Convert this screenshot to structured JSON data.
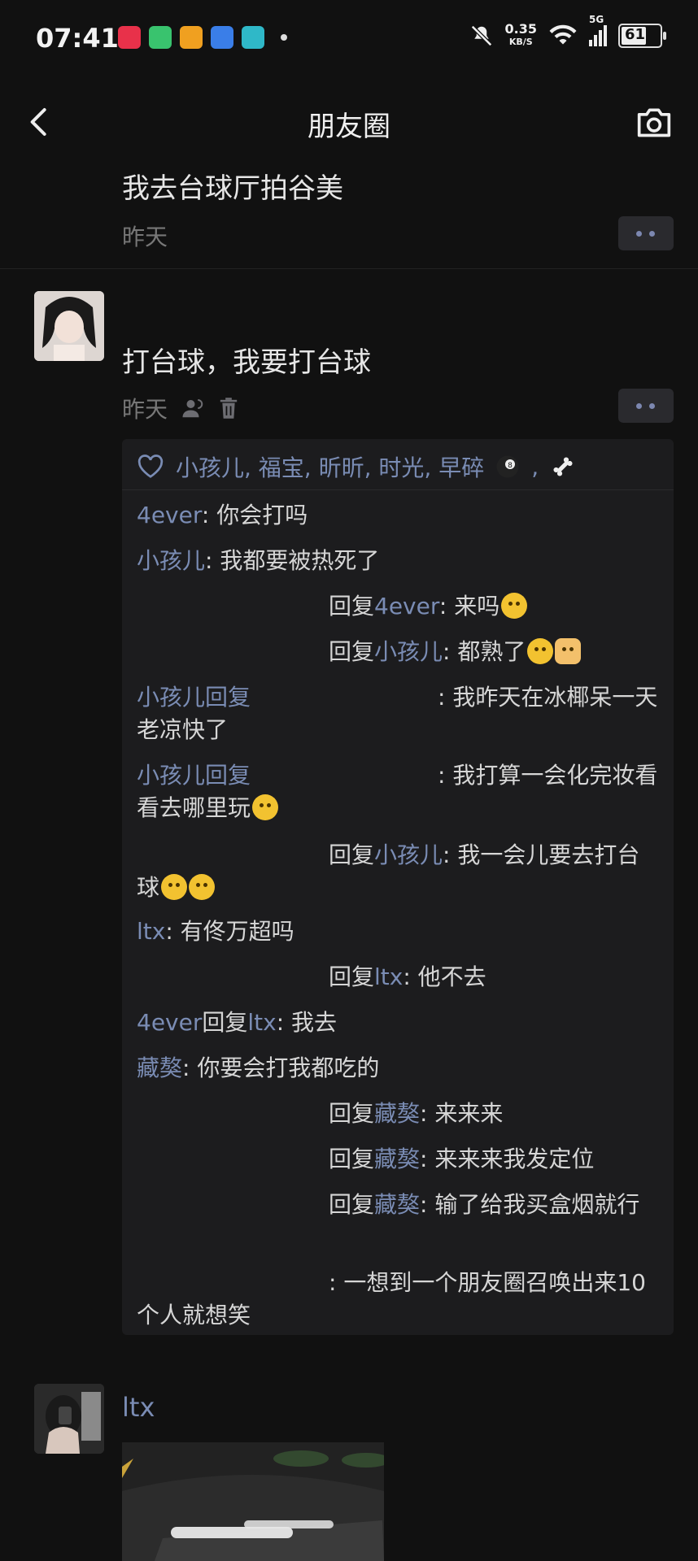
{
  "status_bar": {
    "time": "07:41",
    "speed_value": "0.35",
    "speed_unit": "KB/S",
    "network": "5G",
    "battery": "61"
  },
  "header": {
    "title": "朋友圈"
  },
  "posts": [
    {
      "text": "我去台球厅拍谷美",
      "time": "昨天"
    },
    {
      "text": "打台球，我要打台球",
      "time": "昨天"
    }
  ],
  "likes": "小孩儿, 福宝, 昕昕, 时光, 早碎",
  "comments": [
    {
      "name": "4ever",
      "reply_to": "",
      "text": ": 你会打吗"
    },
    {
      "name": "小孩儿",
      "reply_to": "",
      "text": ": 我都要被热死了"
    },
    {
      "name": "",
      "reply_prefix": "回复",
      "reply_to": "4ever",
      "text": ": 来吗"
    },
    {
      "name": "",
      "reply_prefix": "回复",
      "reply_to": "小孩儿",
      "text": ": 都熟了"
    },
    {
      "name": "小孩儿",
      "reply_prefix": "回复",
      "reply_to": "",
      "text": ": 我昨天在冰椰呆一天老凉快了"
    },
    {
      "name": "小孩儿",
      "reply_prefix": "回复",
      "reply_to": "",
      "text": ": 我打算一会化完妆看看去哪里玩"
    },
    {
      "name": "",
      "reply_prefix": "回复",
      "reply_to": "小孩儿",
      "text": ": 我一会儿要去打台球"
    },
    {
      "name": "ltx",
      "reply_to": "",
      "text": ": 有佟万超吗"
    },
    {
      "name": "",
      "reply_prefix": "回复",
      "reply_to": "ltx",
      "text": ": 他不去"
    },
    {
      "name": "4ever",
      "reply_prefix": "回复",
      "reply_to": "ltx",
      "text": ": 我去"
    },
    {
      "name": "藏獒",
      "reply_to": "",
      "text": ": 你要会打我都吃的"
    },
    {
      "name": "",
      "reply_prefix": "回复",
      "reply_to": "藏獒",
      "text": ": 来来来"
    },
    {
      "name": "",
      "reply_prefix": "回复",
      "reply_to": "藏獒",
      "text": ": 来来来我发定位"
    },
    {
      "name": "",
      "reply_prefix": "回复",
      "reply_to": "藏獒",
      "text": ": 输了给我买盒烟就行"
    },
    {
      "name": "",
      "reply_to": "",
      "text": ": 一想到一个朋友圈召唤出来10个人就想笑"
    }
  ],
  "next_post": {
    "name": "ltx"
  },
  "colors": {
    "background": "#111111",
    "link": "#7a8cb4",
    "panel": "#1c1c1e"
  }
}
